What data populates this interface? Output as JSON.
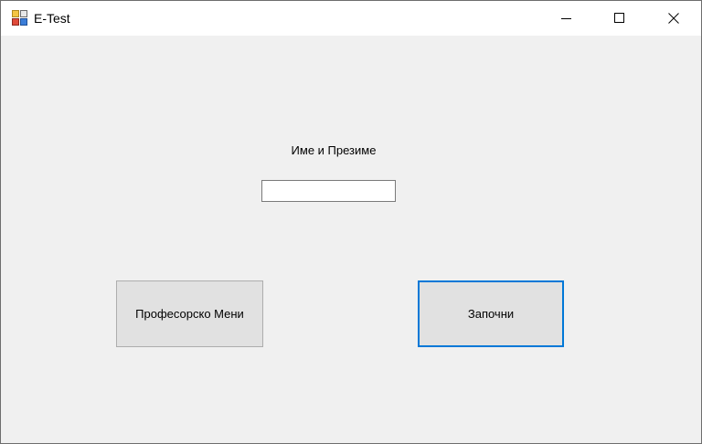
{
  "window": {
    "title": "E-Test",
    "icon": "app-forms-icon",
    "controls": {
      "minimize_icon": "minimize-icon",
      "maximize_icon": "maximize-icon",
      "close_icon": "close-icon"
    }
  },
  "form": {
    "name_label": "Име и Презиме",
    "name_input_value": "",
    "professor_menu_button": "Професорско Мени",
    "start_button": "Започни"
  },
  "colors": {
    "form_background": "#f0f0f0",
    "titlebar_background": "#ffffff",
    "button_background": "#e1e1e1",
    "focus_accent": "#0078d7"
  }
}
